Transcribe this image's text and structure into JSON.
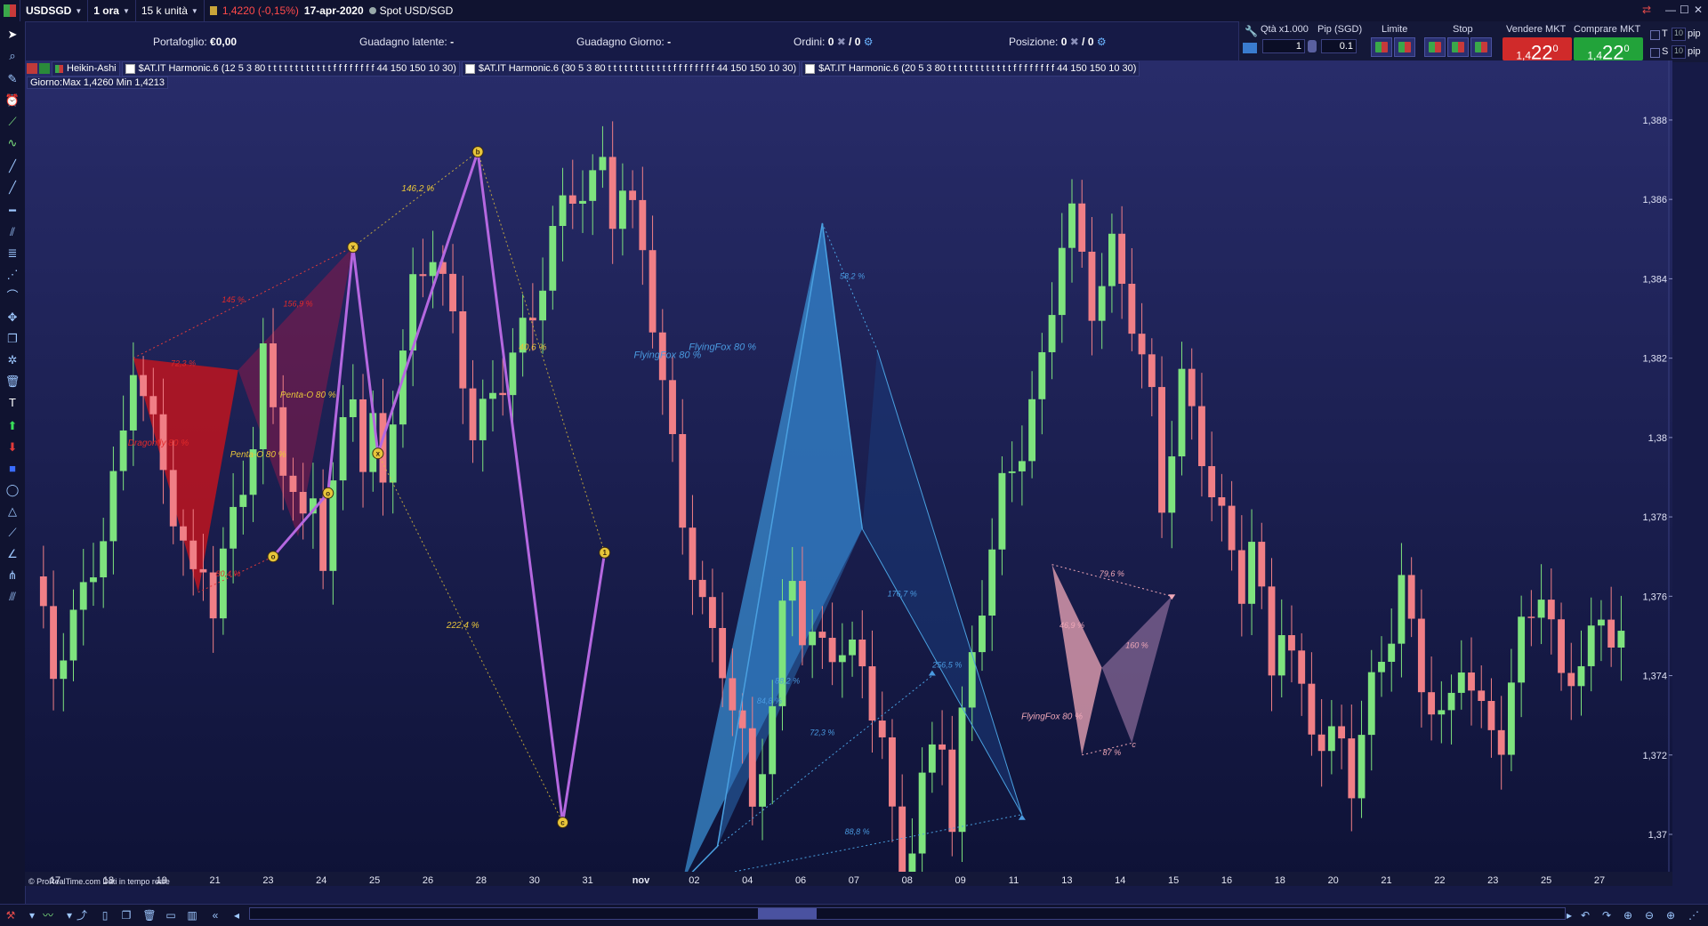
{
  "titlebar": {
    "symbol": "USDSGD",
    "timeframe": "1 ora",
    "units": "15 k unità",
    "quote": "1,4220 (-0,15%)",
    "date": "17-apr-2020",
    "source": "Spot USD/SGD"
  },
  "account": {
    "portfolio_label": "Portafoglio:",
    "portfolio_value": "€0,00",
    "unrealized_label": "Guadagno latente:",
    "unrealized_value": "-",
    "daily_label": "Guadagno Giorno:",
    "daily_value": "-",
    "orders_label": "Ordini:",
    "orders_a": "0",
    "orders_b": "/ 0",
    "position_label": "Posizione:",
    "position_a": "0",
    "position_b": "/ 0"
  },
  "trade": {
    "qty_label": "Qtà x1.000",
    "qty_value": "1",
    "pip_label": "Pip (SGD)",
    "pip_value": "0.1",
    "limit_label": "Limite",
    "stop_label": "Stop",
    "sell_label": "Vendere MKT",
    "buy_label": "Comprare MKT",
    "sell_prefix": "1,4",
    "sell_big": "22",
    "sell_sup": "0",
    "buy_prefix": "1,4",
    "buy_big": "22",
    "buy_sup": "0",
    "t_label": "T",
    "s_label": "S",
    "t_pip_value": "10",
    "s_pip_value": "10",
    "pip_unit": "pip"
  },
  "legend": {
    "ha": "Heikin-Ashi",
    "h1": "$AT.IT Harmonic.6 (12 5 3 80 t t t t t t t t t t t t f f f f f f f f 44 150 150 10 30)",
    "h2": "$AT.IT Harmonic.6 (30 5 3 80 t t t t t t t t t t t t f f f f f f f f 44 150 150 10 30)",
    "h3": "$AT.IT Harmonic.6 (20 5 3 80 t t t t t t t t t t t t f f f f f f f f 44 150 150 10 30)"
  },
  "day_info": "Giorno:Max 1,4260 Min 1,4213",
  "credits": "© ProRealTime.com  Dati in tempo reale",
  "colors": {
    "background": "#161a46",
    "bull": "#7ee37e",
    "bear": "#f07f86",
    "red_pattern": "#c0141e",
    "purple_line": "#b568e0",
    "blue_pattern": "#3a8cd0",
    "pink_pattern": "#f0a8b8",
    "gold_label": "#e7c53a"
  },
  "chart_data": {
    "type": "candlestick",
    "y_ticks": [
      "1,388",
      "1,386",
      "1,384",
      "1,382",
      "1,38",
      "1,378",
      "1,376",
      "1,374",
      "1,372",
      "1,37"
    ],
    "ylim": [
      1.3687,
      1.3895
    ],
    "x_ticks": [
      "17",
      "18",
      "19",
      "21",
      "23",
      "24",
      "25",
      "26",
      "28",
      "30",
      "31",
      "nov",
      "02",
      "04",
      "06",
      "07",
      "08",
      "09",
      "11",
      "13",
      "14",
      "15",
      "16",
      "18",
      "20",
      "21",
      "22",
      "23",
      "25",
      "27"
    ],
    "path": [
      [
        0,
        1.3765
      ],
      [
        2,
        1.3737
      ],
      [
        5,
        1.376
      ],
      [
        7,
        1.378
      ],
      [
        9,
        1.3802
      ],
      [
        10,
        1.382
      ],
      [
        12,
        1.3798
      ],
      [
        14,
        1.378
      ],
      [
        16,
        1.3765
      ],
      [
        17,
        1.3772
      ],
      [
        18,
        1.3761
      ],
      [
        20,
        1.378
      ],
      [
        22,
        1.3795
      ],
      [
        23,
        1.3816
      ],
      [
        25,
        1.3795
      ],
      [
        27,
        1.378
      ],
      [
        28,
        1.379
      ],
      [
        29,
        1.3772
      ],
      [
        31,
        1.38
      ],
      [
        32,
        1.381
      ],
      [
        33,
        1.379
      ],
      [
        34,
        1.38
      ],
      [
        35,
        1.3788
      ],
      [
        36,
        1.381
      ],
      [
        38,
        1.384
      ],
      [
        40,
        1.3848
      ],
      [
        42,
        1.3825
      ],
      [
        44,
        1.38
      ],
      [
        46,
        1.3812
      ],
      [
        48,
        1.3825
      ],
      [
        50,
        1.383
      ],
      [
        52,
        1.3848
      ],
      [
        54,
        1.386
      ],
      [
        56,
        1.3866
      ],
      [
        57,
        1.3872
      ],
      [
        58,
        1.386
      ],
      [
        59,
        1.3865
      ],
      [
        61,
        1.3845
      ],
      [
        63,
        1.381
      ],
      [
        65,
        1.378
      ],
      [
        67,
        1.376
      ],
      [
        69,
        1.3745
      ],
      [
        71,
        1.372
      ],
      [
        72,
        1.3703
      ],
      [
        74,
        1.373
      ],
      [
        75,
        1.3755
      ],
      [
        76,
        1.3768
      ],
      [
        77,
        1.3755
      ],
      [
        79,
        1.3748
      ],
      [
        81,
        1.3745
      ],
      [
        83,
        1.3738
      ],
      [
        85,
        1.3725
      ],
      [
        86,
        1.3705
      ],
      [
        87,
        1.369
      ],
      [
        89,
        1.3715
      ],
      [
        91,
        1.3722
      ],
      [
        92,
        1.37
      ],
      [
        93,
        1.3725
      ],
      [
        95,
        1.376
      ],
      [
        97,
        1.379
      ],
      [
        99,
        1.38
      ],
      [
        101,
        1.3815
      ],
      [
        102,
        1.383
      ],
      [
        103,
        1.3848
      ],
      [
        104,
        1.3854
      ],
      [
        106,
        1.3836
      ],
      [
        108,
        1.385
      ],
      [
        110,
        1.383
      ],
      [
        112,
        1.3805
      ],
      [
        113,
        1.378
      ],
      [
        115,
        1.3815
      ],
      [
        117,
        1.38
      ],
      [
        119,
        1.378
      ],
      [
        121,
        1.376
      ],
      [
        122,
        1.377
      ],
      [
        124,
        1.374
      ],
      [
        125,
        1.3755
      ],
      [
        127,
        1.3738
      ],
      [
        129,
        1.3725
      ],
      [
        131,
        1.372
      ],
      [
        132,
        1.371
      ],
      [
        134,
        1.3735
      ],
      [
        136,
        1.3755
      ],
      [
        137,
        1.3767
      ],
      [
        139,
        1.374
      ],
      [
        141,
        1.3725
      ],
      [
        142,
        1.373
      ],
      [
        143,
        1.3742
      ],
      [
        145,
        1.373
      ],
      [
        147,
        1.3728
      ],
      [
        149,
        1.3752
      ],
      [
        151,
        1.376
      ],
      [
        153,
        1.3735
      ],
      [
        155,
        1.3745
      ],
      [
        157,
        1.3757
      ],
      [
        159,
        1.3752
      ]
    ],
    "patterns": [
      {
        "name": "Dragonfly 80 %",
        "color": "red",
        "points": [
          [
            10,
            1.382
          ],
          [
            16.5,
            1.3761
          ],
          [
            20.5,
            1.3817
          ],
          [
            32,
            1.3848
          ]
        ],
        "labels": [
          {
            "t": "145 %",
            "x": 20,
            "y": 1.3834
          },
          {
            "t": "156,9 %",
            "x": 26.5,
            "y": 1.3833
          },
          {
            "t": "72,3 %",
            "x": 15,
            "y": 1.3818
          },
          {
            "t": "80,4 %",
            "x": 19.5,
            "y": 1.3765
          }
        ]
      },
      {
        "name": "purple_harmonic",
        "color": "purple",
        "points": [
          [
            24,
            1.377
          ],
          [
            29.5,
            1.3786
          ],
          [
            32,
            1.3848
          ],
          [
            34.5,
            1.3796
          ],
          [
            44.5,
            1.3872
          ],
          [
            53,
            1.3703
          ],
          [
            57.2,
            1.3771
          ]
        ],
        "circles": [
          {
            "t": "o",
            "x": 24,
            "y": 1.377
          },
          {
            "t": "o",
            "x": 29.5,
            "y": 1.3786
          },
          {
            "t": "x",
            "x": 32,
            "y": 1.3848
          },
          {
            "t": "x",
            "x": 34.5,
            "y": 1.3796
          },
          {
            "t": "b",
            "x": 44.5,
            "y": 1.3872
          },
          {
            "t": "c",
            "x": 53,
            "y": 1.3703
          },
          {
            "t": "1",
            "x": 57.2,
            "y": 1.3771
          }
        ],
        "labels": [
          {
            "t": "Penta-O 80 %",
            "x": 27.5,
            "y": 1.381
          },
          {
            "t": "Penta-O 80 %",
            "x": 22.5,
            "y": 1.3795
          },
          {
            "t": "146,2 %",
            "x": 38.5,
            "y": 1.3862
          },
          {
            "t": "40,6 %",
            "x": 50,
            "y": 1.3822
          },
          {
            "t": "222,4 %",
            "x": 43,
            "y": 1.3752
          }
        ],
        "dotted": [
          [
            [
              32,
              1.3848
            ],
            [
              44.5,
              1.3872
            ]
          ],
          [
            [
              44.5,
              1.3872
            ],
            [
              57.2,
              1.3771
            ]
          ],
          [
            [
              34.5,
              1.3796
            ],
            [
              53,
              1.3703
            ]
          ]
        ]
      },
      {
        "name": "FlyingFox 80 %",
        "color": "blue",
        "points": [
          [
            65,
            1.3688
          ],
          [
            68.5,
            1.3697
          ],
          [
            79,
            1.3854
          ],
          [
            83,
            1.3777
          ],
          [
            84.5,
            1.3822
          ],
          [
            90,
            1.374
          ],
          [
            99,
            1.3705
          ]
        ],
        "labels": [
          {
            "t": "FlyingFox 80 %",
            "x": 63.5,
            "y": 1.382
          },
          {
            "t": "FlyingFox 80 %",
            "x": 69,
            "y": 1.3822
          },
          {
            "t": "58,2 %",
            "x": 82,
            "y": 1.384
          },
          {
            "t": "176,7 %",
            "x": 87,
            "y": 1.376
          },
          {
            "t": "256,5 %",
            "x": 91.5,
            "y": 1.3742
          },
          {
            "t": "72,3 %",
            "x": 79,
            "y": 1.3725
          },
          {
            "t": "88,8 %",
            "x": 82.5,
            "y": 1.37
          },
          {
            "t": "88,2 %",
            "x": 75.5,
            "y": 1.3738
          },
          {
            "t": "84,8 %",
            "x": 73.7,
            "y": 1.3733
          }
        ]
      },
      {
        "name": "FlyingFox 80 %",
        "color": "pink",
        "points": [
          [
            102,
            1.3768
          ],
          [
            105,
            1.372
          ],
          [
            107,
            1.3742
          ],
          [
            110,
            1.3723
          ],
          [
            114,
            1.376
          ]
        ],
        "labels": [
          {
            "t": "FlyingFox 80 %",
            "x": 102,
            "y": 1.3729
          },
          {
            "t": "79,6 %",
            "x": 108,
            "y": 1.3765
          },
          {
            "t": "46,9 %",
            "x": 104,
            "y": 1.3752
          },
          {
            "t": "160 %",
            "x": 110.5,
            "y": 1.3747
          },
          {
            "t": "87 %",
            "x": 108,
            "y": 1.372
          },
          {
            "t": "c",
            "x": 110.2,
            "y": 1.3722
          }
        ]
      }
    ]
  }
}
